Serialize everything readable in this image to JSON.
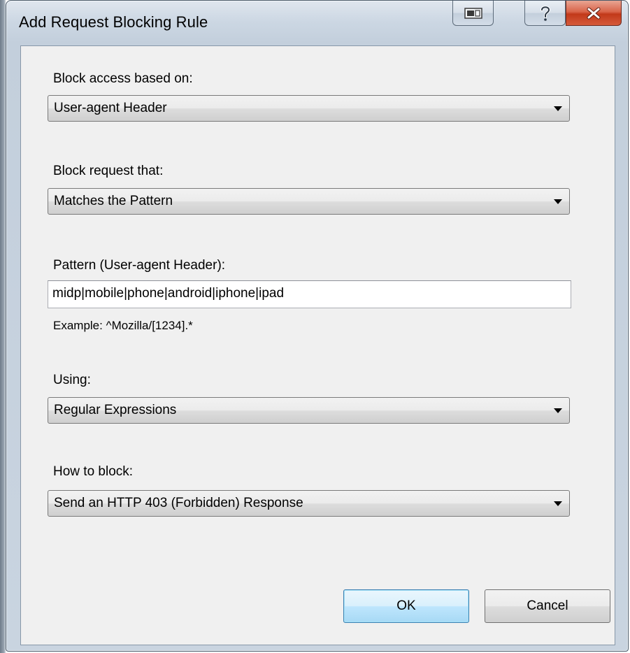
{
  "window": {
    "title": "Add Request Blocking Rule"
  },
  "icons": {
    "caption_button_1": "window-layout-icon",
    "help": "question-mark-icon",
    "close": "close-x-icon",
    "dropdown": "chevron-down-icon"
  },
  "colors": {
    "close_button": "#c9432a",
    "default_button_border": "#3c7fb1",
    "dialog_face": "#f0f0f0"
  },
  "form": {
    "block_access": {
      "label": "Block access based on:",
      "value": "User-agent Header"
    },
    "block_request": {
      "label": "Block request that:",
      "value": "Matches the Pattern"
    },
    "pattern": {
      "label": "Pattern (User-agent Header):",
      "value": "midp|mobile|phone|android|iphone|ipad",
      "example": "Example: ^Mozilla/[1234].*"
    },
    "using": {
      "label": "Using:",
      "value": "Regular Expressions"
    },
    "how_to_block": {
      "label": "How to block:",
      "value": "Send an HTTP 403 (Forbidden) Response"
    }
  },
  "buttons": {
    "ok": "OK",
    "cancel": "Cancel"
  }
}
